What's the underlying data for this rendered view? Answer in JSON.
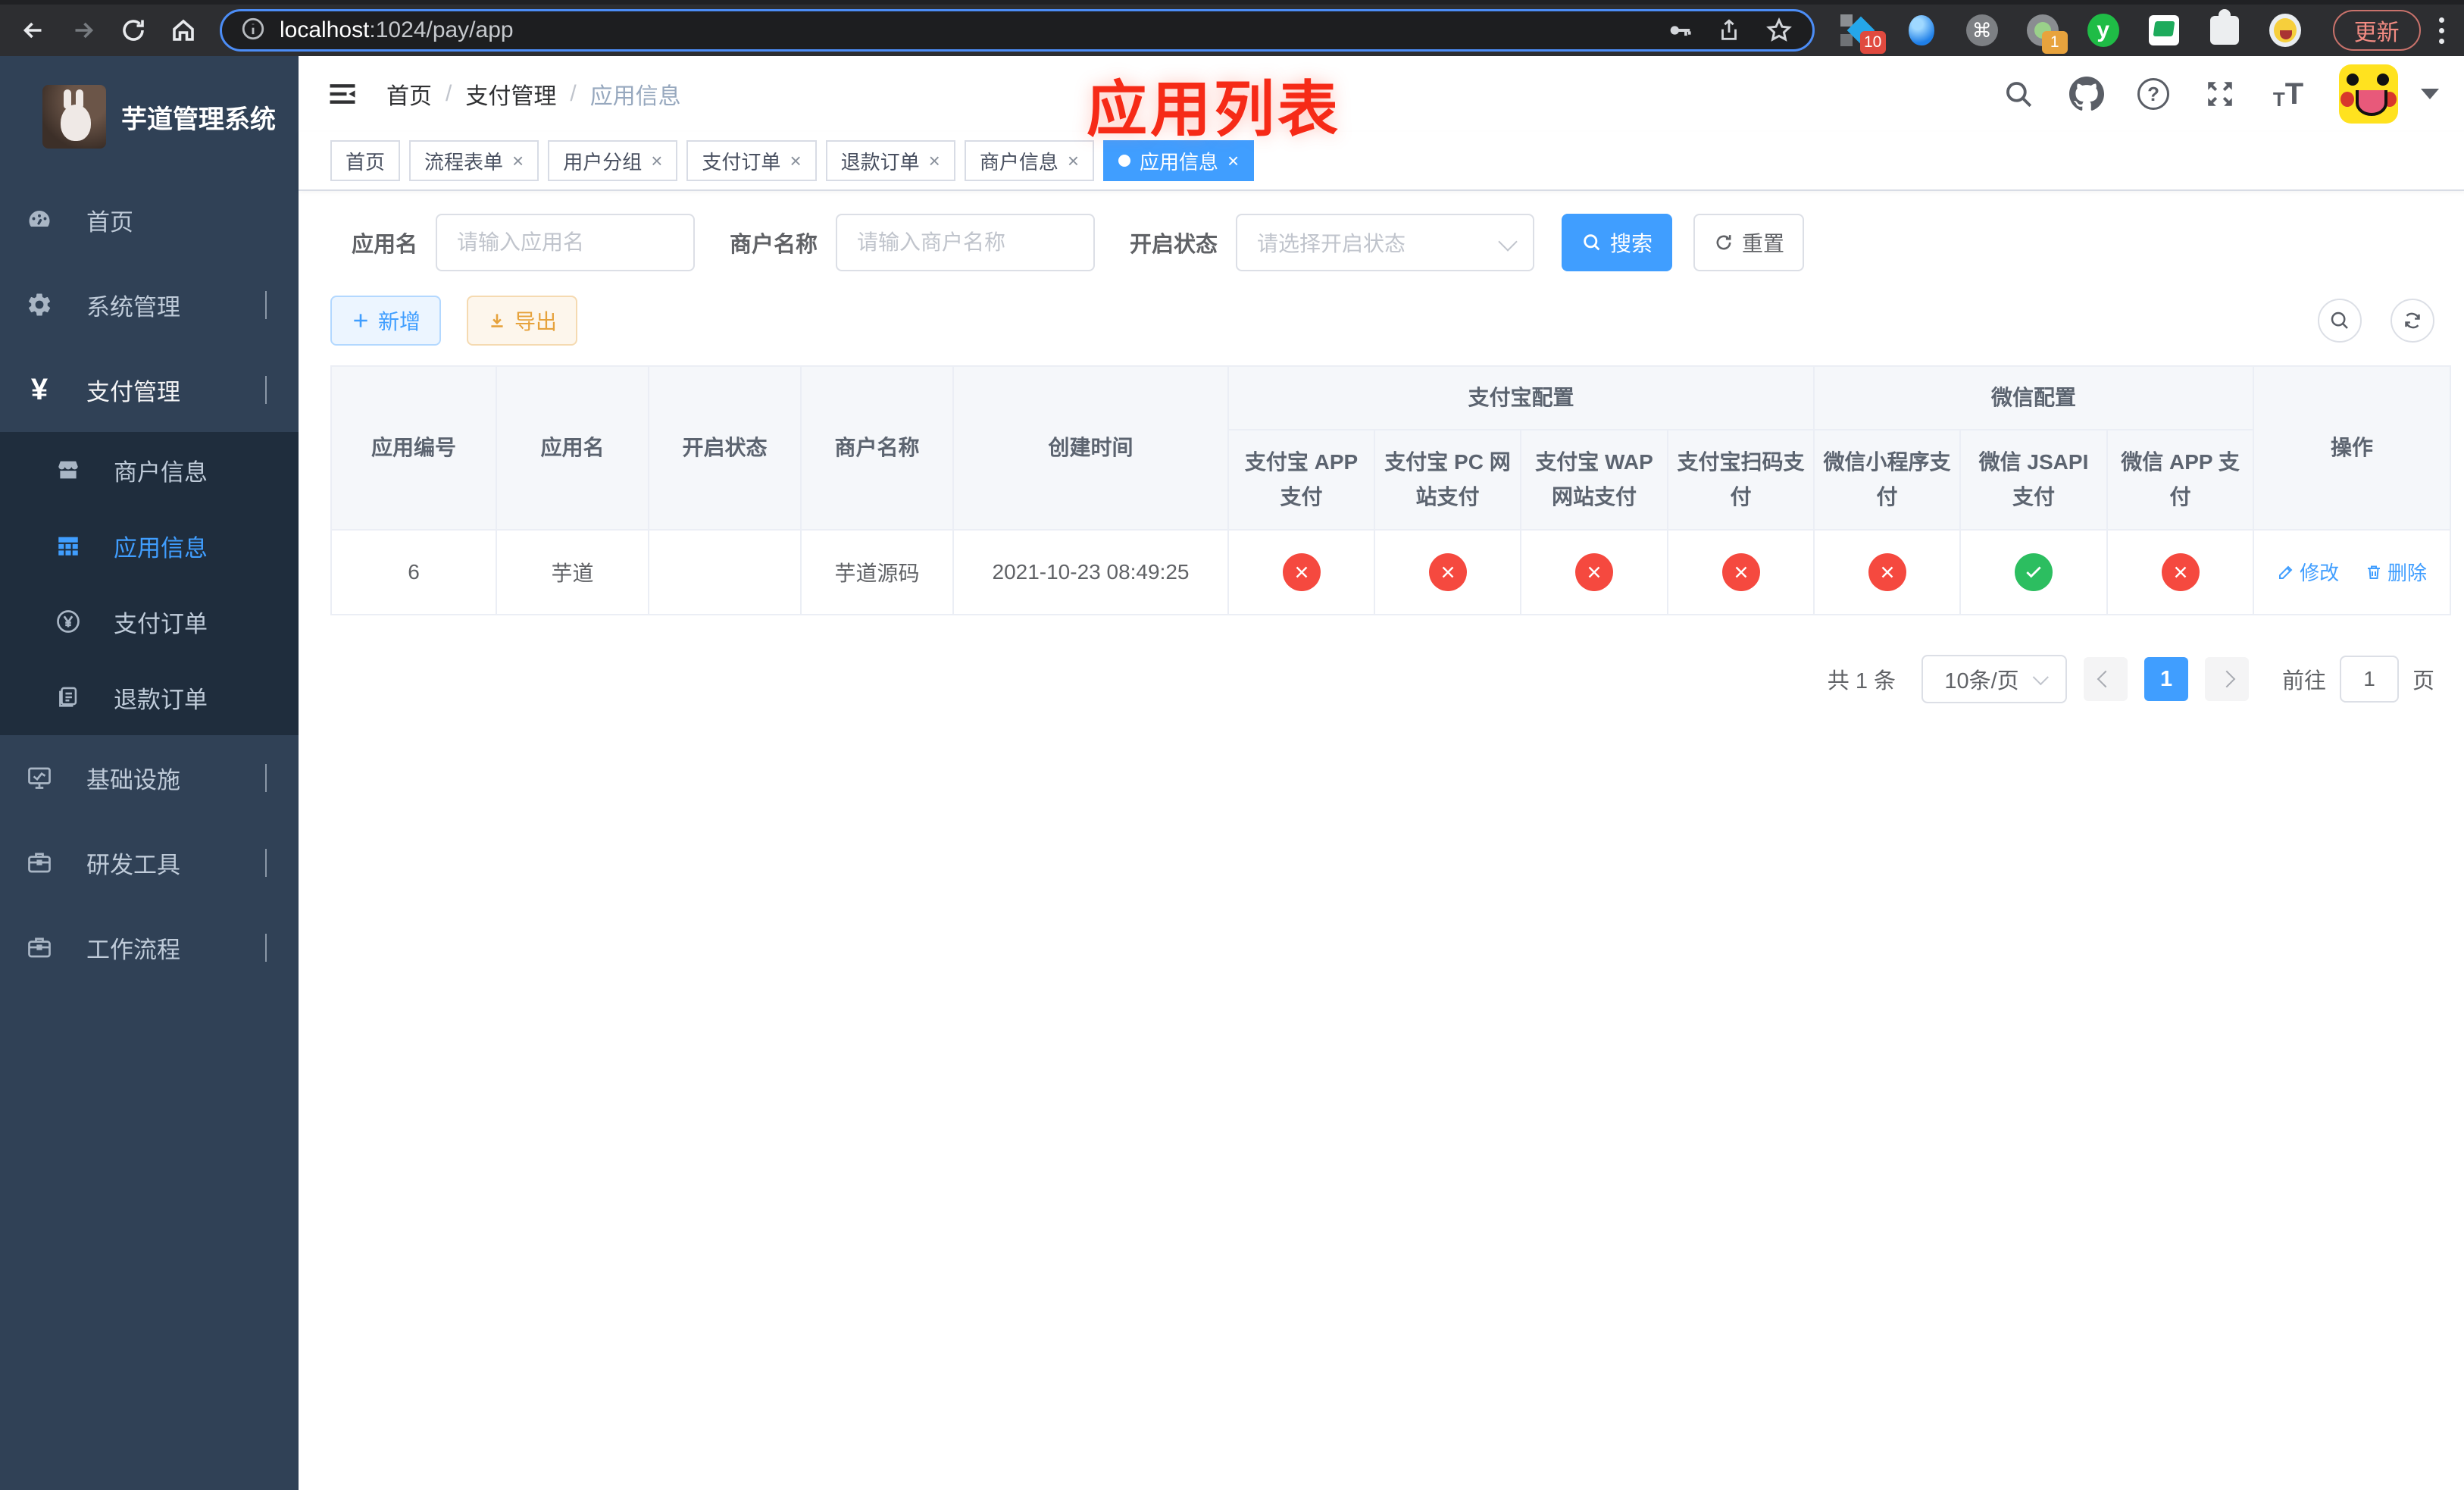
{
  "browser": {
    "url_host": "localhost",
    "url_path": ":1024/pay/app",
    "update_label": "更新",
    "ext_badge_notifications": "10",
    "ext_badge_counter": "1",
    "ext_y_letter": "y",
    "ext_command_glyph": "⌘"
  },
  "sidebar": {
    "title": "芋道管理系统",
    "items": [
      {
        "label": "首页"
      },
      {
        "label": "系统管理"
      },
      {
        "label": "支付管理"
      },
      {
        "label": "基础设施"
      },
      {
        "label": "研发工具"
      },
      {
        "label": "工作流程"
      }
    ],
    "payment_children": [
      {
        "label": "商户信息"
      },
      {
        "label": "应用信息"
      },
      {
        "label": "支付订单"
      },
      {
        "label": "退款订单"
      }
    ]
  },
  "header": {
    "breadcrumb": [
      "首页",
      "支付管理",
      "应用信息"
    ],
    "annotation": "应用列表"
  },
  "tabs": [
    {
      "label": "首页",
      "closable": false
    },
    {
      "label": "流程表单",
      "closable": true
    },
    {
      "label": "用户分组",
      "closable": true
    },
    {
      "label": "支付订单",
      "closable": true
    },
    {
      "label": "退款订单",
      "closable": true
    },
    {
      "label": "商户信息",
      "closable": true
    },
    {
      "label": "应用信息",
      "closable": true,
      "active": true
    }
  ],
  "filters": {
    "app_name_label": "应用名",
    "app_name_placeholder": "请输入应用名",
    "merchant_label": "商户名称",
    "merchant_placeholder": "请输入商户名称",
    "status_label": "开启状态",
    "status_placeholder": "请选择开启状态",
    "search_label": "搜索",
    "reset_label": "重置"
  },
  "toolbar": {
    "add_label": "新增",
    "export_label": "导出"
  },
  "table": {
    "col_app_id": "应用编号",
    "col_app_name": "应用名",
    "col_status": "开启状态",
    "col_merchant": "商户名称",
    "col_created": "创建时间",
    "group_alipay": "支付宝配置",
    "group_wechat": "微信配置",
    "col_actions": "操作",
    "alipay_cols": [
      "支付宝 APP 支付",
      "支付宝 PC 网站支付",
      "支付宝 WAP 网站支付",
      "支付宝扫码支付"
    ],
    "wechat_cols": [
      "微信小程序支付",
      "微信 JSAPI 支付",
      "微信 APP 支付"
    ],
    "row": {
      "app_id": "6",
      "app_name": "芋道",
      "enabled": true,
      "merchant": "芋道源码",
      "created": "2021-10-23 08:49:25",
      "channels": [
        "no",
        "no",
        "no",
        "no",
        "no",
        "yes",
        "no"
      ],
      "edit_label": "修改",
      "delete_label": "删除"
    }
  },
  "pagination": {
    "total": "共 1 条",
    "page_size": "10条/页",
    "current_page": "1",
    "goto_label": "前往",
    "goto_value": "1",
    "goto_suffix": "页"
  },
  "colors": {
    "accent": "#409eff",
    "danger": "#f5493f",
    "success": "#2cbe60",
    "annotation_red": "#f62a17",
    "sidebar_bg": "#304156",
    "submenu_bg": "#1f2d3d"
  }
}
